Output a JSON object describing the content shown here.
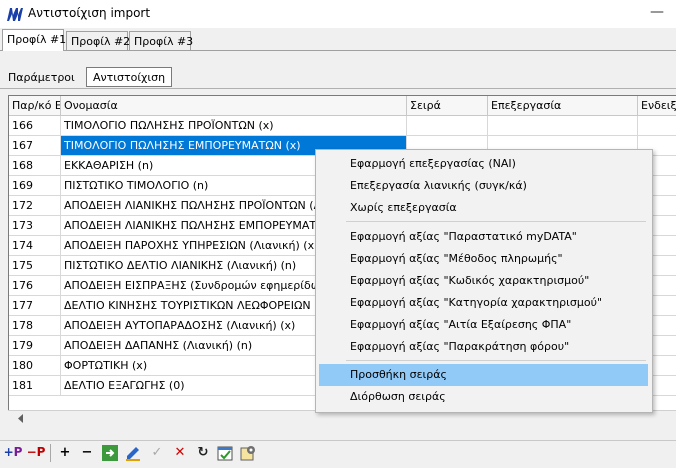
{
  "window": {
    "title": "Αντιστοίχιση import"
  },
  "profile_tabs": [
    "Προφίλ #1",
    "Προφίλ #2",
    "Προφίλ #3"
  ],
  "inner_tabs": {
    "params": "Παράμετροι",
    "mapping": "Αντιστοίχιση"
  },
  "grid": {
    "columns": [
      "Παρ/κό Ε",
      "Ονομασία",
      "Σειρά",
      "Επεξεργασία",
      "Ενδειξη"
    ],
    "rows": [
      {
        "code": "166",
        "name": "ΤΙΜΟΛΟΓΙΟ ΠΩΛΗΣΗΣ ΠΡΟΪΟΝΤΩΝ (x)"
      },
      {
        "code": "167",
        "name": "ΤΙΜΟΛΟΓΙΟ ΠΩΛΗΣΗΣ ΕΜΠΟΡΕΥΜΑΤΩΝ (x)"
      },
      {
        "code": "168",
        "name": "ΕΚΚΑΘΑΡΙΣΗ (n)"
      },
      {
        "code": "169",
        "name": "ΠΙΣΤΩΤΙΚΟ ΤΙΜΟΛΟΓΙΟ (n)"
      },
      {
        "code": "172",
        "name": "ΑΠΟΔΕΙΞΗ ΛΙΑΝΙΚΗΣ ΠΩΛΗΣΗΣ ΠΡΟΪΟΝΤΩΝ (Λιανικ"
      },
      {
        "code": "173",
        "name": "ΑΠΟΔΕΙΞΗ ΛΙΑΝΙΚΗΣ ΠΩΛΗΣΗΣ ΕΜΠΟΡΕΥΜΑΤΩΝ (Λ"
      },
      {
        "code": "174",
        "name": "ΑΠΟΔΕΙΞΗ ΠΑΡΟΧΗΣ ΥΠΗΡΕΣΙΩΝ (Λιανική) (x)"
      },
      {
        "code": "175",
        "name": "ΠΙΣΤΩΤΙΚΟ ΔΕΛΤΙΟ ΛΙΑΝΙΚΗΣ (Λιανική) (n)"
      },
      {
        "code": "176",
        "name": "ΑΠΟΔΕΙΞΗ ΕΙΣΠΡΑΞΗΣ (Συνδρομών εφημερίδων κα"
      },
      {
        "code": "177",
        "name": "ΔΕΛΤΙΟ ΚΙΝΗΣΗΣ ΤΟΥΡΙΣΤΙΚΩΝ ΛΕΩΦΟΡΕΙΩΝ (Λιαν"
      },
      {
        "code": "178",
        "name": "ΑΠΟΔΕΙΞΗ ΑΥΤΟΠΑΡΑΔΟΣΗΣ (Λιανική) (x)"
      },
      {
        "code": "179",
        "name": "ΑΠΟΔΕΙΞΗ ΔΑΠΑΝΗΣ (Λιανική) (n)"
      },
      {
        "code": "180",
        "name": "ΦΟΡΤΩΤΙΚΗ (x)"
      },
      {
        "code": "181",
        "name": "ΔΕΛΤΙΟ ΕΞΑΓΩΓΗΣ (0)"
      }
    ],
    "selected_row_code": "167"
  },
  "context_menu": {
    "items": [
      "Εφαρμογή επεξεργασίας (ΝΑΙ)",
      "Επεξεργασία λιανικής (συγκ/κά)",
      "Χωρίς επεξεργασία",
      "Εφαρμογή αξίας \"Παραστατικό myDATA\"",
      "Εφαρμογή αξίας \"Μέθοδος πληρωμής\"",
      "Εφαρμογή αξίας \"Κωδικός χαρακτηρισμού\"",
      "Εφαρμογή αξίας \"Κατηγορία χαρακτηρισμού\"",
      "Εφαρμογή αξίας \"Αιτία Εξαίρεσης ΦΠΑ\"",
      "Εφαρμογή αξίας \"Παρακράτηση φόρου\"",
      "Προσθήκη σειράς",
      "Διόρθωση σειράς"
    ],
    "highlighted": "Προσθήκη σειράς"
  },
  "toolbar": {
    "add_profile": "+P",
    "remove_profile": "−P",
    "add": "+",
    "remove": "−",
    "icons": [
      "add-profile-icon",
      "remove-profile-icon",
      "add-icon",
      "remove-icon",
      "import-icon",
      "edit-icon",
      "confirm-icon",
      "cancel-icon",
      "refresh-icon",
      "apply-icon",
      "settings-icon"
    ]
  },
  "colors": {
    "selection": "#0078d7",
    "menu_highlight": "#91c9f7",
    "brand": "#1a3fa8"
  }
}
